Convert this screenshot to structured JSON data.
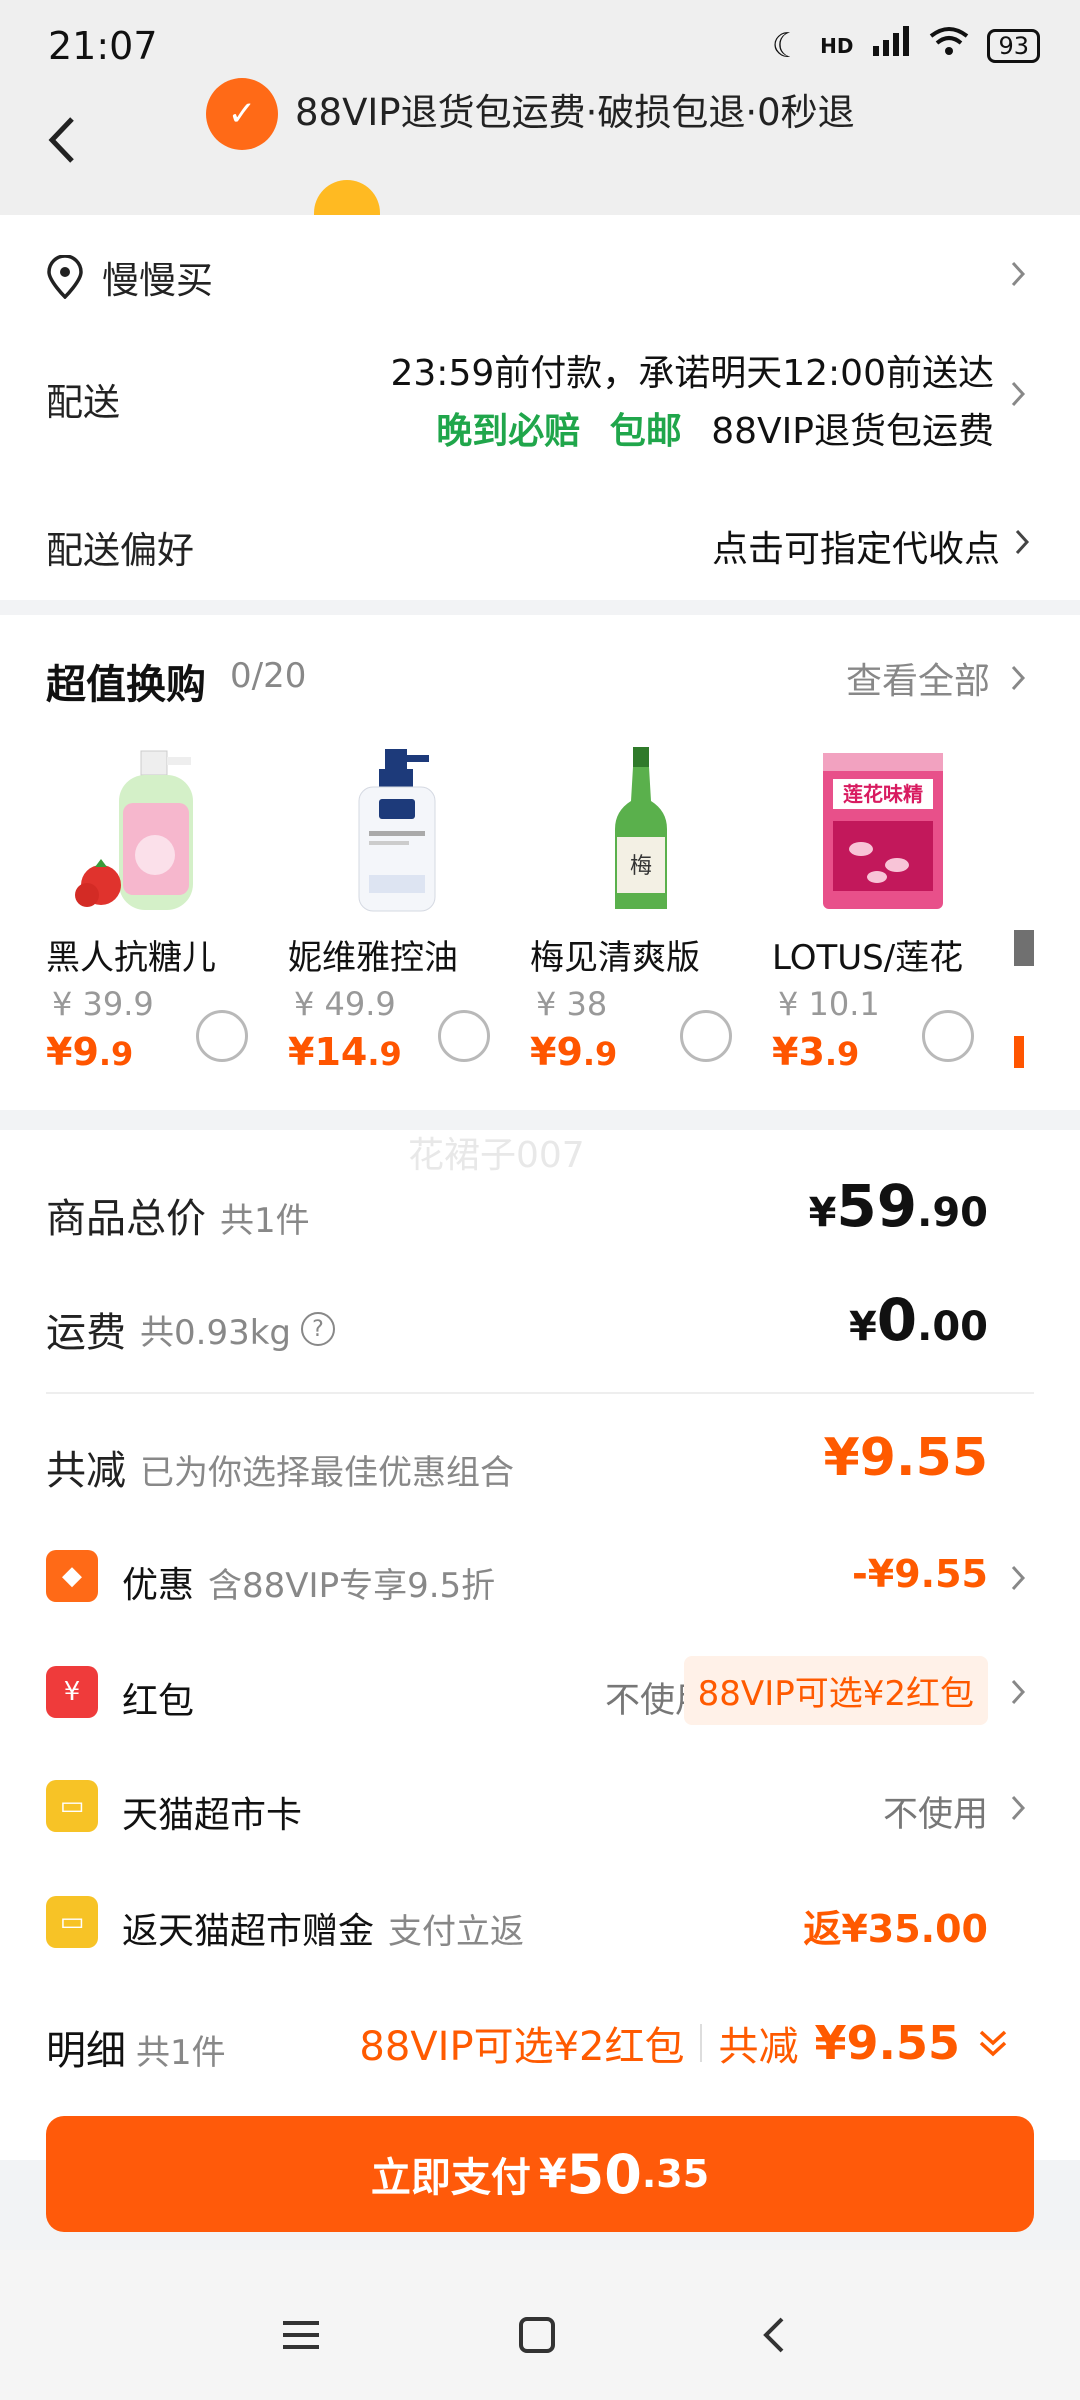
{
  "status_bar": {
    "time": "21:07",
    "network": "HD",
    "battery": "93"
  },
  "header": {
    "banner_text": "88VIP退货包运费·破损包退·0秒退"
  },
  "address": {
    "label": "慢慢买"
  },
  "delivery": {
    "label": "配送",
    "line1": "23:59前付款，承诺明天12:00前送达",
    "tag1": "晚到必赔",
    "tag2": "包邮",
    "tag3": "88VIP退货包运费"
  },
  "preference": {
    "label": "配送偏好",
    "value": "点击可指定代收点"
  },
  "exchange": {
    "title": "超值换购",
    "count": "0/20",
    "view_all": "查看全部",
    "products": [
      {
        "name": "黑人抗糖儿",
        "orig": "¥ 39.9",
        "price_int": "¥9",
        "price_dec": ".9"
      },
      {
        "name": "妮维雅控油",
        "orig": "¥ 49.9",
        "price_int": "¥14",
        "price_dec": ".9"
      },
      {
        "name": "梅见清爽版",
        "orig": "¥ 38",
        "price_int": "¥9",
        "price_dec": ".9"
      },
      {
        "name": "LOTUS/莲花",
        "orig": "¥ 10.1",
        "price_int": "¥3",
        "price_dec": ".9"
      }
    ]
  },
  "watermark": "花裙子007",
  "summary": {
    "goods_label": "商品总价",
    "goods_count": "共1件",
    "goods_cur": "¥",
    "goods_int": "59",
    "goods_dec": ".90",
    "freight_label": "运费",
    "freight_weight": "共0.93kg",
    "freight_cur": "¥",
    "freight_int": "0",
    "freight_dec": ".00",
    "reduce_label": "共减",
    "reduce_note": "已为你选择最佳优惠组合",
    "reduce_amount": "¥9.55",
    "discount_label": "优惠",
    "discount_note": "含88VIP专享9.5折",
    "discount_amount": "-¥9.55",
    "redpacket_label": "红包",
    "redpacket_value": "不使用",
    "redpacket_pill": "88VIP可选¥2红包",
    "card_label": "天猫超市卡",
    "card_value": "不使用",
    "cashback_label": "返天猫超市赠金",
    "cashback_note": "支付立返",
    "cashback_amount": "返¥35.00"
  },
  "detail": {
    "label": "明细",
    "count": "共1件",
    "redpacket": "88VIP可选¥2红包",
    "reduce_label": "共减",
    "reduce_amount": "¥9.55"
  },
  "pay": {
    "label": "立即支付",
    "cur": "¥",
    "int": "50",
    "dec": ".35"
  },
  "colors": {
    "accent": "#ff5a00",
    "green": "#20a64b"
  }
}
